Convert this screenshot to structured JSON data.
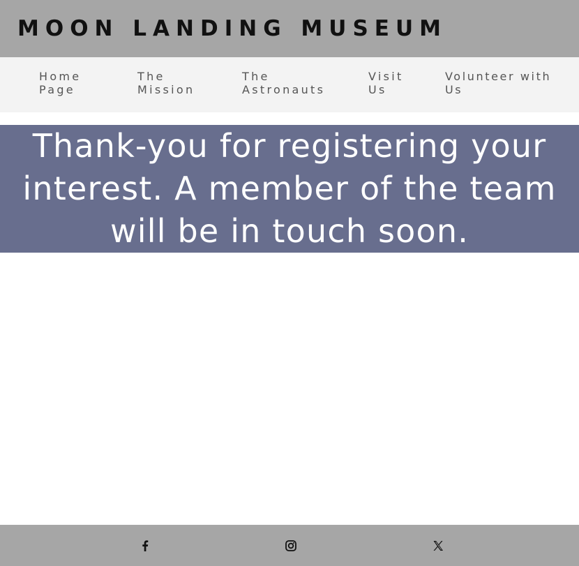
{
  "header": {
    "title": "MOON LANDING MUSEUM"
  },
  "nav": {
    "items": [
      {
        "lines": [
          "Home",
          "Page"
        ]
      },
      {
        "lines": [
          "The",
          "Mission"
        ]
      },
      {
        "lines": [
          "The",
          "Astronauts"
        ]
      },
      {
        "lines": [
          "Visit",
          "Us"
        ]
      },
      {
        "lines": [
          "Volunteer with",
          "Us"
        ]
      }
    ]
  },
  "banner": {
    "lines": [
      "Thank-you for registering your",
      "interest. A member of the team",
      "will be in touch soon."
    ]
  },
  "footer": {
    "social": [
      {
        "icon": "facebook-icon"
      },
      {
        "icon": "instagram-icon"
      },
      {
        "icon": "x-twitter-icon"
      }
    ]
  },
  "colors": {
    "header_bg": "#a6a6a6",
    "nav_bg": "#f3f3f3",
    "banner_bg": "#686e8e",
    "footer_bg": "#a6a6a6"
  }
}
